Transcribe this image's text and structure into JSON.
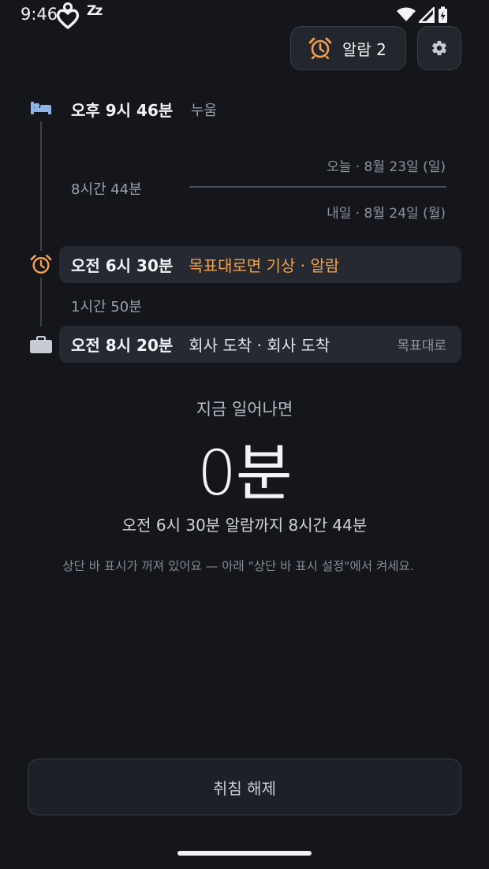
{
  "status_bar": {
    "time": "9:46",
    "zz": "Zz",
    "icons": [
      "app-heart-icon",
      "wifi-icon",
      "signal-icon",
      "battery-charging-icon"
    ]
  },
  "header": {
    "alarm_button_label": "알람 2",
    "settings_icon": "gear-icon"
  },
  "timeline": {
    "bed": {
      "time": "오후 9시 46분",
      "label": "누움",
      "icon": "bed-icon"
    },
    "sleep_duration": "8시간 44분",
    "dates": {
      "today": "오늘 · 8월 23일 (일)",
      "tomorrow": "내일 · 8월 24일 (월)"
    },
    "alarm": {
      "time": "오전 6시 30분",
      "label": "목표대로면 기상 · 알람",
      "icon": "alarm-clock-icon"
    },
    "commute_duration": "1시간 50분",
    "arrive": {
      "time": "오전 8시 20분",
      "label": "회사 도착 · 회사 도착",
      "tag": "목표대로",
      "icon": "briefcase-icon"
    }
  },
  "summary": {
    "caption": "지금 일어나면",
    "value": "0분",
    "alarm_until": "오전 6시 30분 알람까지 8시간 44분",
    "notice": "상단 바 표시가 꺼져 있어요 — 아래 \"상단 바 표시 설정\"에서 켜세요."
  },
  "footer": {
    "cancel_label": "취침 해제"
  },
  "colors": {
    "background": "#14161b",
    "accent_orange": "#f0a24a",
    "bed_blue": "#8fb4e8"
  }
}
